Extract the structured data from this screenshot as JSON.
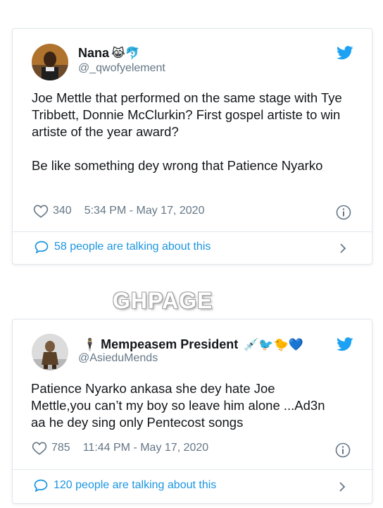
{
  "tweets": [
    {
      "name": "Nana",
      "name_emojis": "😹🐬",
      "handle": "@_qwofyelement",
      "text": "Joe Mettle that performed on the same stage with Tye Tribbett, Donnie McClurkin? First gospel artiste to win artiste of the year award?\n\nBe like something dey wrong that Patience Nyarko",
      "likes": "340",
      "timestamp": "5:34 PM - May 17, 2020",
      "talking": "58 people are talking about this"
    },
    {
      "name_prefix_emoji": "🕴",
      "name": "Mempeasem President",
      "name_emojis": "💉🐦🐤💙",
      "handle": "@AsieduMends",
      "text": "Patience Nyarko ankasa she dey hate Joe Mettle,you can’t my boy so leave him alone ...Ad3n aa he dey sing only Pentecost songs",
      "likes": "785",
      "timestamp": "11:44 PM - May 17, 2020",
      "talking": "120 people are talking about this"
    }
  ],
  "watermark": "GHPAGE",
  "colors": {
    "twitter_blue": "#1da1f2",
    "link_blue": "#1b95e0",
    "muted": "#657786",
    "border": "#e1e8ed"
  },
  "icons": [
    "twitter-bird-icon",
    "heart-icon",
    "info-icon",
    "speech-bubble-icon",
    "chevron-right-icon"
  ]
}
